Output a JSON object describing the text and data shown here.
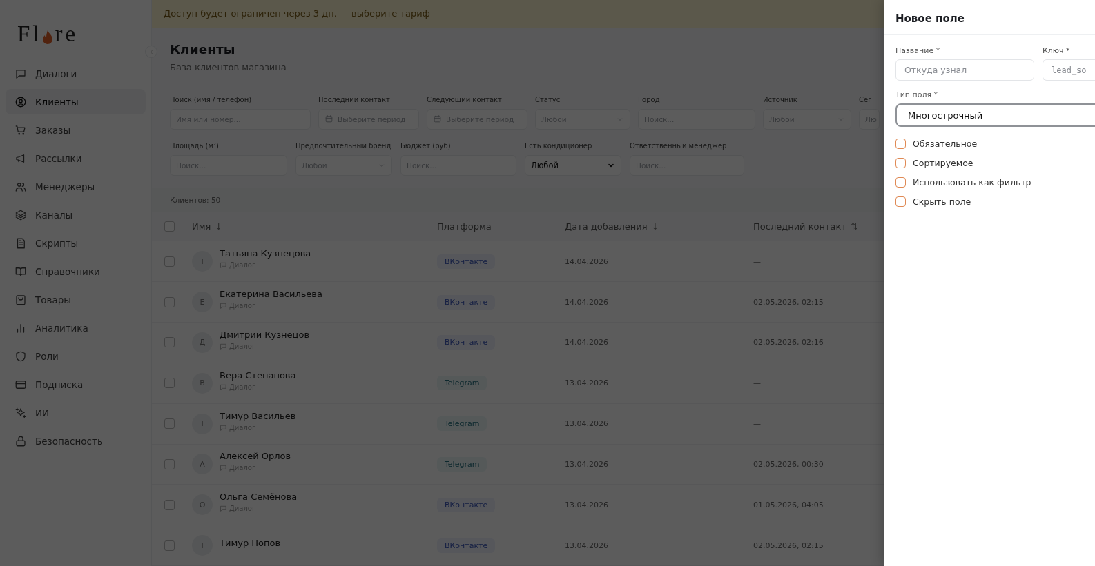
{
  "banner": {
    "text": "Доступ будет ограничен через 3 дн. — выберите тариф"
  },
  "sidebar": {
    "logo": {
      "before": "Fl",
      "after": "re"
    },
    "items": [
      {
        "label": "Диалоги",
        "selected": false
      },
      {
        "label": "Клиенты",
        "selected": true
      },
      {
        "label": "Заказы",
        "selected": false
      },
      {
        "label": "Рассылки",
        "selected": false
      },
      {
        "label": "Менеджеры",
        "selected": false
      },
      {
        "label": "Каналы",
        "selected": false
      },
      {
        "label": "Скрипты",
        "selected": false
      },
      {
        "label": "Справочники",
        "selected": false
      },
      {
        "label": "Товары",
        "selected": false
      },
      {
        "label": "Аналитика",
        "selected": false
      },
      {
        "label": "Роли",
        "selected": false
      },
      {
        "label": "Подписка",
        "selected": false
      },
      {
        "label": "ИИ",
        "selected": false
      },
      {
        "label": "Безопасность",
        "selected": false
      }
    ]
  },
  "page": {
    "title": "Клиенты",
    "subtitle": "База клиентов магазина"
  },
  "filters": [
    {
      "label": "Поиск (имя / телефон)",
      "kind": "text",
      "placeholder": "Имя или номер..."
    },
    {
      "label": "Последний контакт",
      "kind": "date",
      "placeholder": "Выберите период"
    },
    {
      "label": "Следующий контакт",
      "kind": "date",
      "placeholder": "Выберите период"
    },
    {
      "label": "Статус",
      "kind": "select",
      "placeholder": "Любой"
    },
    {
      "label": "Город",
      "kind": "text",
      "placeholder": "Поиск..."
    },
    {
      "label": "Источник",
      "kind": "select",
      "placeholder": "Любой"
    },
    {
      "label": "Сег",
      "kind": "select",
      "placeholder": "Лю"
    },
    {
      "label": "Площадь (м²)",
      "kind": "text",
      "placeholder": "Поиск..."
    },
    {
      "label": "Предпочтительный бренд",
      "kind": "select",
      "placeholder": "Любой"
    },
    {
      "label": "Бюджет (руб)",
      "kind": "text",
      "placeholder": "Поиск..."
    },
    {
      "label": "Есть кондиционер",
      "kind": "native-select",
      "value": "Любой"
    },
    {
      "label": "Ответственный менеджер",
      "kind": "text",
      "placeholder": "Поиск..."
    }
  ],
  "count": "Клиентов: 50",
  "table": {
    "select_all": {
      "checked": false
    },
    "columns": [
      {
        "label": "Имя",
        "sort": "↓"
      },
      {
        "label": "Платформа"
      },
      {
        "label": "Дата добавления",
        "sort": "↓"
      },
      {
        "label": "Последний контакт",
        "sort": "⇅"
      }
    ],
    "rows": [
      {
        "checked": false,
        "initial": "Т",
        "name": "Татьяна Кузнецова",
        "subtitle": "Диалог",
        "platform": {
          "label": "ВКонтакте",
          "kind": "vk"
        },
        "added": "14.04.2026",
        "last_contact": "—"
      },
      {
        "checked": false,
        "initial": "Е",
        "name": "Екатерина Васильева",
        "subtitle": "Диалог",
        "platform": {
          "label": "ВКонтакте",
          "kind": "vk"
        },
        "added": "14.04.2026",
        "last_contact": "02.05.2026, 02:15"
      },
      {
        "checked": false,
        "initial": "Д",
        "name": "Дмитрий Кузнецов",
        "subtitle": "Диалог",
        "platform": {
          "label": "ВКонтакте",
          "kind": "vk"
        },
        "added": "14.04.2026",
        "last_contact": "02.05.2026, 02:16"
      },
      {
        "checked": false,
        "initial": "В",
        "name": "Вера Степанова",
        "subtitle": "Диалог",
        "platform": {
          "label": "Telegram",
          "kind": "telegram"
        },
        "added": "13.04.2026",
        "last_contact": "—"
      },
      {
        "checked": false,
        "initial": "Т",
        "name": "Тимур Васильев",
        "subtitle": "Диалог",
        "platform": {
          "label": "Telegram",
          "kind": "telegram"
        },
        "added": "13.04.2026",
        "last_contact": "—"
      },
      {
        "checked": false,
        "initial": "А",
        "name": "Алексей Орлов",
        "subtitle": "Диалог",
        "platform": {
          "label": "Telegram",
          "kind": "telegram"
        },
        "added": "13.04.2026",
        "last_contact": "02.05.2026, 00:30"
      },
      {
        "checked": false,
        "initial": "О",
        "name": "Ольга Семёнова",
        "subtitle": "Диалог",
        "platform": {
          "label": "ВКонтакте",
          "kind": "vk"
        },
        "added": "13.04.2026",
        "last_contact": "01.05.2026, 04:05"
      },
      {
        "checked": false,
        "initial": "Т",
        "name": "Тимур Попов",
        "platform": {
          "label": "ВКонтакте",
          "kind": "vk"
        },
        "added": "13.04.2026",
        "last_contact": "02.05.2026, 02:15"
      }
    ]
  },
  "drawer": {
    "title": "Новое поле",
    "fields": [
      {
        "label": "Название *",
        "kind": "text",
        "placeholder": "Откуда узнал"
      },
      {
        "label": "Ключ *",
        "kind": "mono",
        "placeholder": "lead_so"
      }
    ],
    "type_field": {
      "label": "Тип поля *",
      "value": "Многострочный"
    },
    "options": [
      {
        "label": "Обязательное",
        "checked": false
      },
      {
        "label": "Сортируемое",
        "checked": false
      },
      {
        "label": "Использовать как фильтр",
        "checked": false
      },
      {
        "label": "Скрыть поле",
        "checked": false
      }
    ]
  }
}
